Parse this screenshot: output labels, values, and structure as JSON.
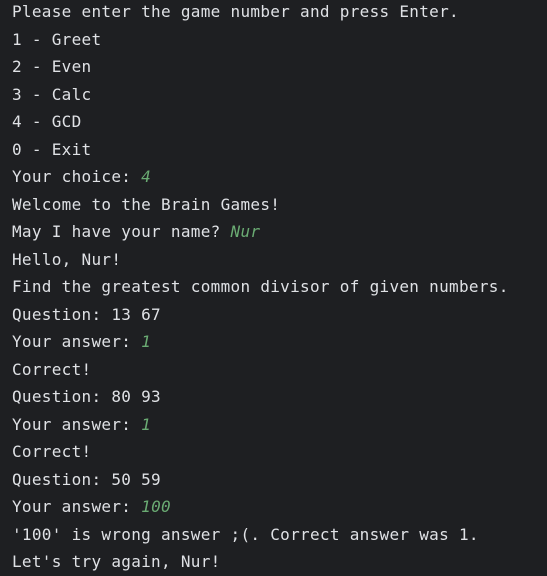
{
  "console": {
    "lines": [
      {
        "text": "Please enter the game number and press Enter.",
        "input": ""
      },
      {
        "text": "1 - Greet",
        "input": ""
      },
      {
        "text": "2 - Even",
        "input": ""
      },
      {
        "text": "3 - Calc",
        "input": ""
      },
      {
        "text": "4 - GCD",
        "input": ""
      },
      {
        "text": "0 - Exit",
        "input": ""
      },
      {
        "text": "Your choice: ",
        "input": "4"
      },
      {
        "text": "Welcome to the Brain Games!",
        "input": ""
      },
      {
        "text": "May I have your name? ",
        "input": "Nur"
      },
      {
        "text": "Hello, Nur!",
        "input": ""
      },
      {
        "text": "Find the greatest common divisor of given numbers.",
        "input": ""
      },
      {
        "text": "Question: 13 67",
        "input": ""
      },
      {
        "text": "Your answer: ",
        "input": "1"
      },
      {
        "text": "Correct!",
        "input": ""
      },
      {
        "text": "Question: 80 93",
        "input": ""
      },
      {
        "text": "Your answer: ",
        "input": "1"
      },
      {
        "text": "Correct!",
        "input": ""
      },
      {
        "text": "Question: 50 59",
        "input": ""
      },
      {
        "text": "Your answer: ",
        "input": "100"
      },
      {
        "text": "'100' is wrong answer ;(. Correct answer was 1.",
        "input": ""
      },
      {
        "text": "Let's try again, Nur!",
        "input": ""
      }
    ]
  },
  "colors": {
    "background": "#1e1f22",
    "output_text": "#dfe1e5",
    "user_input": "#6aab73"
  }
}
